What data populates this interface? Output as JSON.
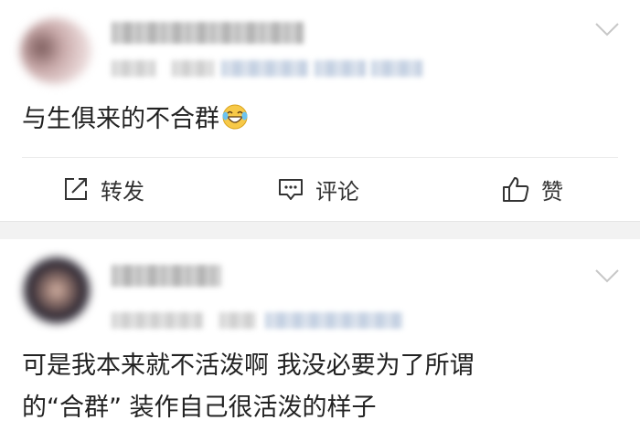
{
  "posts": [
    {
      "text": "与生俱来的不合群",
      "emoji": "laughing-with-tears",
      "actions": {
        "repost_label": "转发",
        "comment_label": "评论",
        "like_label": "赞"
      }
    },
    {
      "text_line1": "可是我本来就不活泼啊 我没必要为了所谓",
      "text_line2": "的“合群” 装作自己很活泼的样子"
    }
  ],
  "colors": {
    "text": "#222222",
    "icon": "#333333",
    "separator": "#f2f2f2",
    "chevron": "#c7c7c7"
  }
}
